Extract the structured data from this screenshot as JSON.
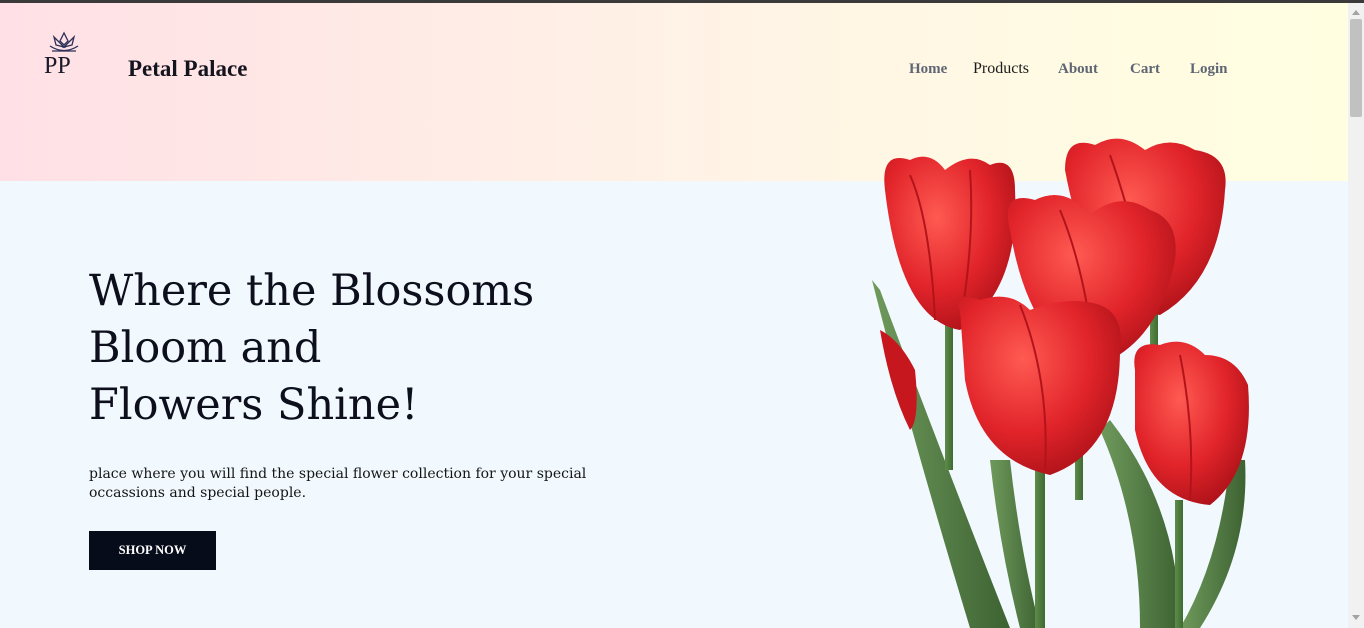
{
  "brand": {
    "logo_text": "PP",
    "name": "Petal Palace"
  },
  "nav": {
    "items": [
      "Home",
      "Products",
      "About",
      "Cart",
      "Login"
    ]
  },
  "hero": {
    "headline_lines": [
      "Where the Blossoms",
      "Bloom and",
      "Flowers Shine!"
    ],
    "tagline": "place where you will find the special flower collection for your special occassions and special people.",
    "cta_label": "SHOP NOW"
  },
  "icons": {
    "logo": "lotus-crown-icon",
    "hero_image": "red-tulips-bouquet-image",
    "scroll_up": "triangle-up-icon",
    "scroll_down": "triangle-down-icon"
  },
  "colors": {
    "header_gradient_start": "#ffe0e6",
    "header_gradient_end": "#fffee1",
    "hero_bg": "#f1f9fe",
    "cta_bg": "#070c1a",
    "tulip_red": "#e3272c",
    "stem_green": "#4b7a3d"
  }
}
